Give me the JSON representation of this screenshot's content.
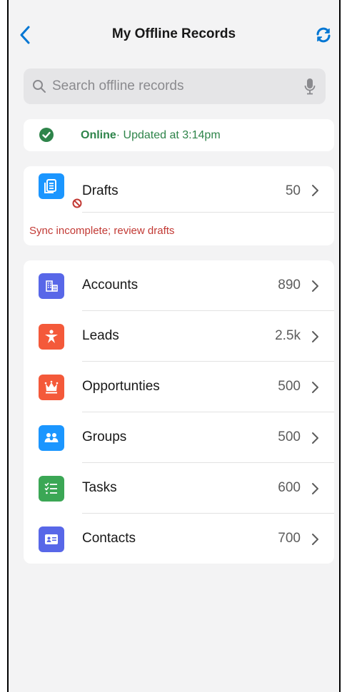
{
  "header": {
    "title": "My Offline Records",
    "back_icon": "chevron-left-icon",
    "refresh_icon": "sync-icon",
    "accent_color": "#0176d3"
  },
  "search": {
    "placeholder": "Search offline records",
    "value": ""
  },
  "status": {
    "state": "Online",
    "detail": " · Updated at 3:14pm",
    "color": "#2e844a"
  },
  "drafts": {
    "label": "Drafts",
    "count": "50",
    "warning": "Sync incomplete; review drafts",
    "warning_color": "#c23934",
    "icon": "drafts-icon",
    "badge_icon": "blocked-icon"
  },
  "records": [
    {
      "label": "Accounts",
      "count": "890",
      "icon": "account-icon",
      "color": "#5867e8"
    },
    {
      "label": "Leads",
      "count": "2.5k",
      "icon": "lead-icon",
      "color": "#f4593a"
    },
    {
      "label": "Opportunties",
      "count": "500",
      "icon": "opportunity-icon",
      "color": "#f4593a"
    },
    {
      "label": "Groups",
      "count": "500",
      "icon": "groups-icon",
      "color": "#1b96ff"
    },
    {
      "label": "Tasks",
      "count": "600",
      "icon": "task-icon",
      "color": "#3ba755"
    },
    {
      "label": "Contacts",
      "count": "700",
      "icon": "contact-icon",
      "color": "#5867e8"
    }
  ]
}
